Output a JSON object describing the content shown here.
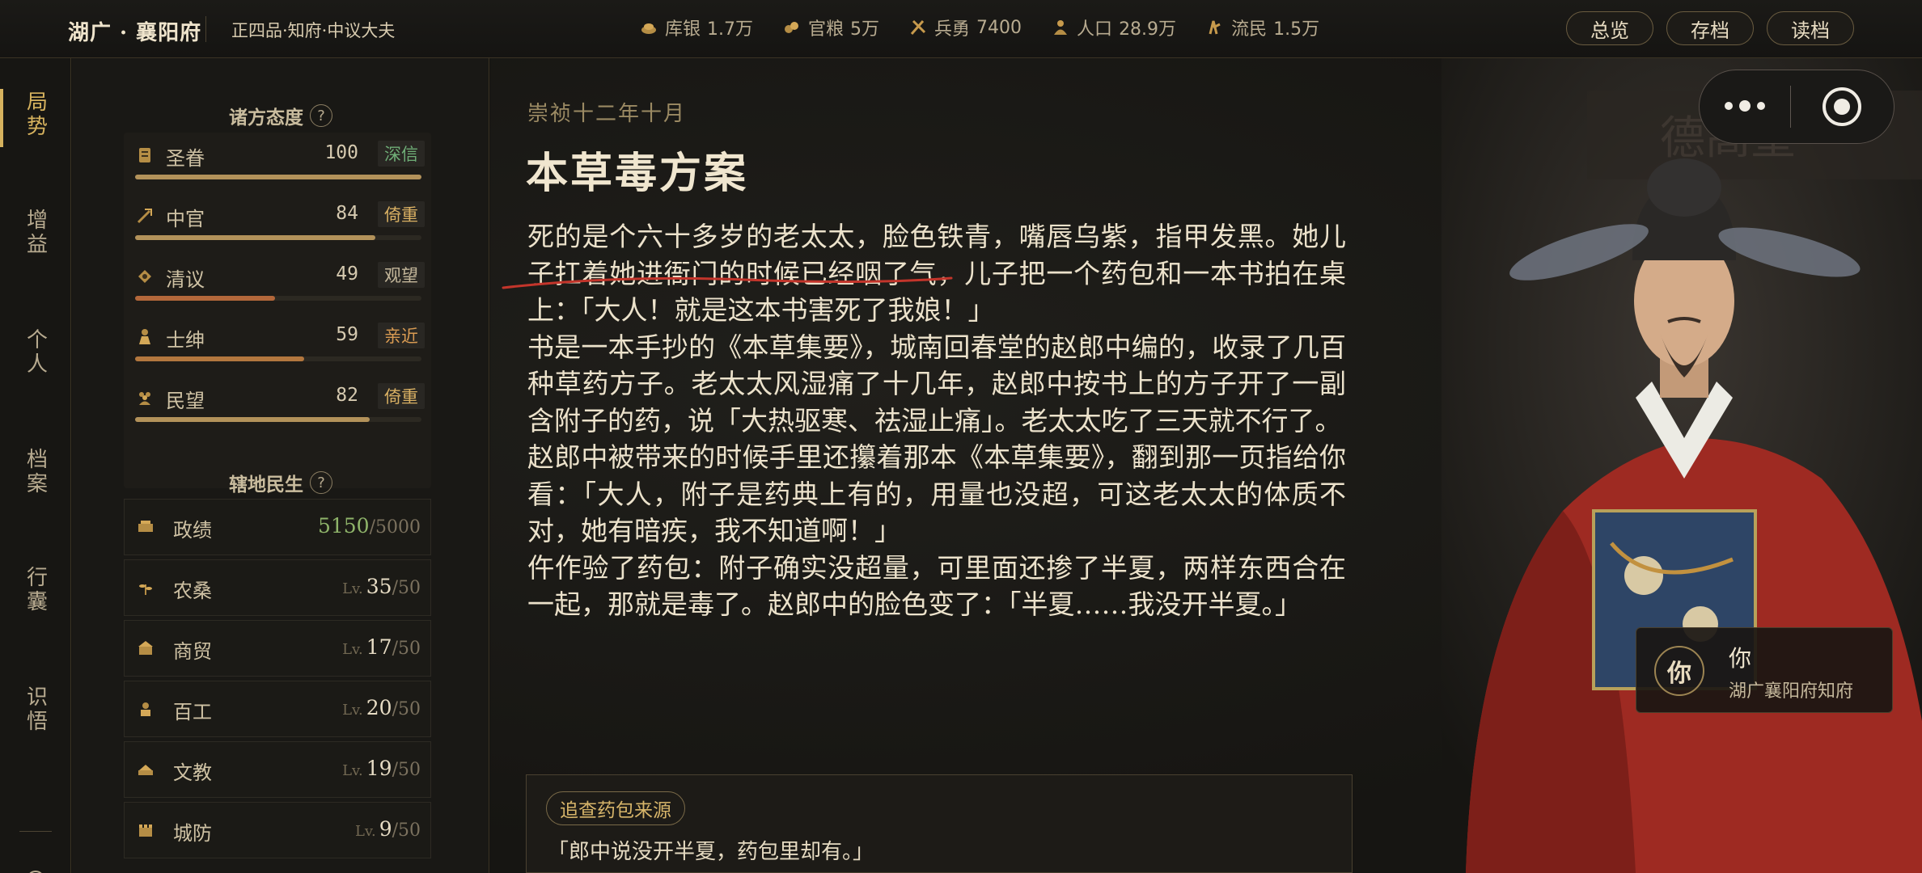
{
  "topbar": {
    "region": "湖广 · 襄阳府",
    "rank": "正四品·知府·中议大夫",
    "stats": [
      {
        "icon": "silver-icon",
        "label": "库银",
        "value": "1.7万"
      },
      {
        "icon": "grain-icon",
        "label": "官粮",
        "value": "5万"
      },
      {
        "icon": "soldier-icon",
        "label": "兵勇",
        "value": "7400"
      },
      {
        "icon": "population-icon",
        "label": "人口",
        "value": "28.9万"
      },
      {
        "icon": "refugee-icon",
        "label": "流民",
        "value": "1.5万"
      }
    ],
    "buttons": {
      "overview": "总览",
      "save": "存档",
      "load": "读档"
    }
  },
  "leftnav": {
    "items": [
      {
        "label": "局势",
        "active": true
      },
      {
        "label": "增益"
      },
      {
        "label": "个人"
      },
      {
        "label": "档案"
      },
      {
        "label": "行囊"
      },
      {
        "label": "识悟"
      }
    ]
  },
  "sidebar": {
    "attitude_title": "诸方态度",
    "help": "?",
    "factions": [
      {
        "icon": "scroll-icon",
        "name": "圣眷",
        "value": 100,
        "tag": "深信",
        "tag_color": "#6fae77",
        "fill_color": "#b3925a",
        "level": 1.0
      },
      {
        "icon": "eunuch-icon",
        "name": "中官",
        "value": 84,
        "tag": "倚重",
        "tag_color": "#d9b063",
        "fill_color": "#b3925a",
        "level": 0.84
      },
      {
        "icon": "scholar-icon",
        "name": "清议",
        "value": 49,
        "tag": "观望",
        "tag_color": "#c4b79b",
        "fill_color": "#b3673a",
        "level": 0.49
      },
      {
        "icon": "gentry-icon",
        "name": "士绅",
        "value": 59,
        "tag": "亲近",
        "tag_color": "#d99b52",
        "fill_color": "#b3773e",
        "level": 0.59
      },
      {
        "icon": "people-icon",
        "name": "民望",
        "value": 82,
        "tag": "倚重",
        "tag_color": "#d9b063",
        "fill_color": "#b3925a",
        "level": 0.82
      }
    ],
    "people_title": "辖地民生",
    "people": [
      {
        "icon": "merit-icon",
        "name": "政绩",
        "current": "5150",
        "max": "/5000",
        "lv": ""
      },
      {
        "icon": "farm-icon",
        "name": "农桑",
        "current": "35",
        "max": "/50",
        "lv": "Lv."
      },
      {
        "icon": "trade-icon",
        "name": "商贸",
        "current": "17",
        "max": "/50",
        "lv": "Lv."
      },
      {
        "icon": "craft-icon",
        "name": "百工",
        "current": "20",
        "max": "/50",
        "lv": "Lv."
      },
      {
        "icon": "education-icon",
        "name": "文教",
        "current": "19",
        "max": "/50",
        "lv": "Lv."
      },
      {
        "icon": "defense-icon",
        "name": "城防",
        "current": "9",
        "max": "/50",
        "lv": "Lv."
      }
    ]
  },
  "story": {
    "date": "崇祯十二年十月",
    "title": "本草毒方案",
    "paragraphs": [
      "死的是个六十多岁的老太太，脸色铁青，嘴唇乌紫，指甲发黑。她儿子扛着她进衙门的时候已经咽了气，儿子把一个药包和一本书拍在桌上：「大人！就是这本书害死了我娘！」",
      "书是一本手抄的《本草集要》，城南回春堂的赵郎中编的，收录了几百种草药方子。老太太风湿痛了十几年，赵郎中按书上的方子开了一副含附子的药，说「大热驱寒、祛湿止痛」。老太太吃了三天就不行了。",
      "赵郎中被带来的时候手里还攥着那本《本草集要》，翻到那一页指给你看：「大人，附子是药典上有的，用量也没超，可这老太太的体质不对，她有暗疾，我不知道啊！」",
      "仵作验了药包：附子确实没超量，可里面还掺了半夏，两样东西合在一起，那就是毒了。赵郎中的脸色变了：「半夏……我没开半夏。」"
    ],
    "choice": {
      "option": "追查药包来源",
      "quote": "「郎中说没开半夏，药包里却有。」"
    }
  },
  "portrait": {
    "you_badge": "你",
    "you_name": "你",
    "you_title": "湖广襄阳府知府"
  }
}
